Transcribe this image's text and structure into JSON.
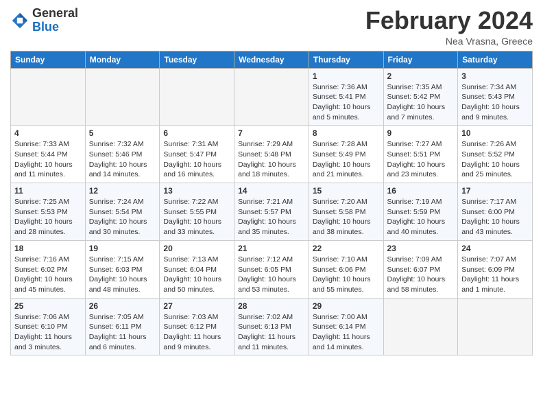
{
  "header": {
    "logo": {
      "general": "General",
      "blue": "Blue"
    },
    "title": "February 2024",
    "location": "Nea Vrasna, Greece"
  },
  "weekdays": [
    "Sunday",
    "Monday",
    "Tuesday",
    "Wednesday",
    "Thursday",
    "Friday",
    "Saturday"
  ],
  "weeks": [
    [
      {
        "day": "",
        "info": ""
      },
      {
        "day": "",
        "info": ""
      },
      {
        "day": "",
        "info": ""
      },
      {
        "day": "",
        "info": ""
      },
      {
        "day": "1",
        "info": "Sunrise: 7:36 AM\nSunset: 5:41 PM\nDaylight: 10 hours\nand 5 minutes."
      },
      {
        "day": "2",
        "info": "Sunrise: 7:35 AM\nSunset: 5:42 PM\nDaylight: 10 hours\nand 7 minutes."
      },
      {
        "day": "3",
        "info": "Sunrise: 7:34 AM\nSunset: 5:43 PM\nDaylight: 10 hours\nand 9 minutes."
      }
    ],
    [
      {
        "day": "4",
        "info": "Sunrise: 7:33 AM\nSunset: 5:44 PM\nDaylight: 10 hours\nand 11 minutes."
      },
      {
        "day": "5",
        "info": "Sunrise: 7:32 AM\nSunset: 5:46 PM\nDaylight: 10 hours\nand 14 minutes."
      },
      {
        "day": "6",
        "info": "Sunrise: 7:31 AM\nSunset: 5:47 PM\nDaylight: 10 hours\nand 16 minutes."
      },
      {
        "day": "7",
        "info": "Sunrise: 7:29 AM\nSunset: 5:48 PM\nDaylight: 10 hours\nand 18 minutes."
      },
      {
        "day": "8",
        "info": "Sunrise: 7:28 AM\nSunset: 5:49 PM\nDaylight: 10 hours\nand 21 minutes."
      },
      {
        "day": "9",
        "info": "Sunrise: 7:27 AM\nSunset: 5:51 PM\nDaylight: 10 hours\nand 23 minutes."
      },
      {
        "day": "10",
        "info": "Sunrise: 7:26 AM\nSunset: 5:52 PM\nDaylight: 10 hours\nand 25 minutes."
      }
    ],
    [
      {
        "day": "11",
        "info": "Sunrise: 7:25 AM\nSunset: 5:53 PM\nDaylight: 10 hours\nand 28 minutes."
      },
      {
        "day": "12",
        "info": "Sunrise: 7:24 AM\nSunset: 5:54 PM\nDaylight: 10 hours\nand 30 minutes."
      },
      {
        "day": "13",
        "info": "Sunrise: 7:22 AM\nSunset: 5:55 PM\nDaylight: 10 hours\nand 33 minutes."
      },
      {
        "day": "14",
        "info": "Sunrise: 7:21 AM\nSunset: 5:57 PM\nDaylight: 10 hours\nand 35 minutes."
      },
      {
        "day": "15",
        "info": "Sunrise: 7:20 AM\nSunset: 5:58 PM\nDaylight: 10 hours\nand 38 minutes."
      },
      {
        "day": "16",
        "info": "Sunrise: 7:19 AM\nSunset: 5:59 PM\nDaylight: 10 hours\nand 40 minutes."
      },
      {
        "day": "17",
        "info": "Sunrise: 7:17 AM\nSunset: 6:00 PM\nDaylight: 10 hours\nand 43 minutes."
      }
    ],
    [
      {
        "day": "18",
        "info": "Sunrise: 7:16 AM\nSunset: 6:02 PM\nDaylight: 10 hours\nand 45 minutes."
      },
      {
        "day": "19",
        "info": "Sunrise: 7:15 AM\nSunset: 6:03 PM\nDaylight: 10 hours\nand 48 minutes."
      },
      {
        "day": "20",
        "info": "Sunrise: 7:13 AM\nSunset: 6:04 PM\nDaylight: 10 hours\nand 50 minutes."
      },
      {
        "day": "21",
        "info": "Sunrise: 7:12 AM\nSunset: 6:05 PM\nDaylight: 10 hours\nand 53 minutes."
      },
      {
        "day": "22",
        "info": "Sunrise: 7:10 AM\nSunset: 6:06 PM\nDaylight: 10 hours\nand 55 minutes."
      },
      {
        "day": "23",
        "info": "Sunrise: 7:09 AM\nSunset: 6:07 PM\nDaylight: 10 hours\nand 58 minutes."
      },
      {
        "day": "24",
        "info": "Sunrise: 7:07 AM\nSunset: 6:09 PM\nDaylight: 11 hours\nand 1 minute."
      }
    ],
    [
      {
        "day": "25",
        "info": "Sunrise: 7:06 AM\nSunset: 6:10 PM\nDaylight: 11 hours\nand 3 minutes."
      },
      {
        "day": "26",
        "info": "Sunrise: 7:05 AM\nSunset: 6:11 PM\nDaylight: 11 hours\nand 6 minutes."
      },
      {
        "day": "27",
        "info": "Sunrise: 7:03 AM\nSunset: 6:12 PM\nDaylight: 11 hours\nand 9 minutes."
      },
      {
        "day": "28",
        "info": "Sunrise: 7:02 AM\nSunset: 6:13 PM\nDaylight: 11 hours\nand 11 minutes."
      },
      {
        "day": "29",
        "info": "Sunrise: 7:00 AM\nSunset: 6:14 PM\nDaylight: 11 hours\nand 14 minutes."
      },
      {
        "day": "",
        "info": ""
      },
      {
        "day": "",
        "info": ""
      }
    ]
  ]
}
